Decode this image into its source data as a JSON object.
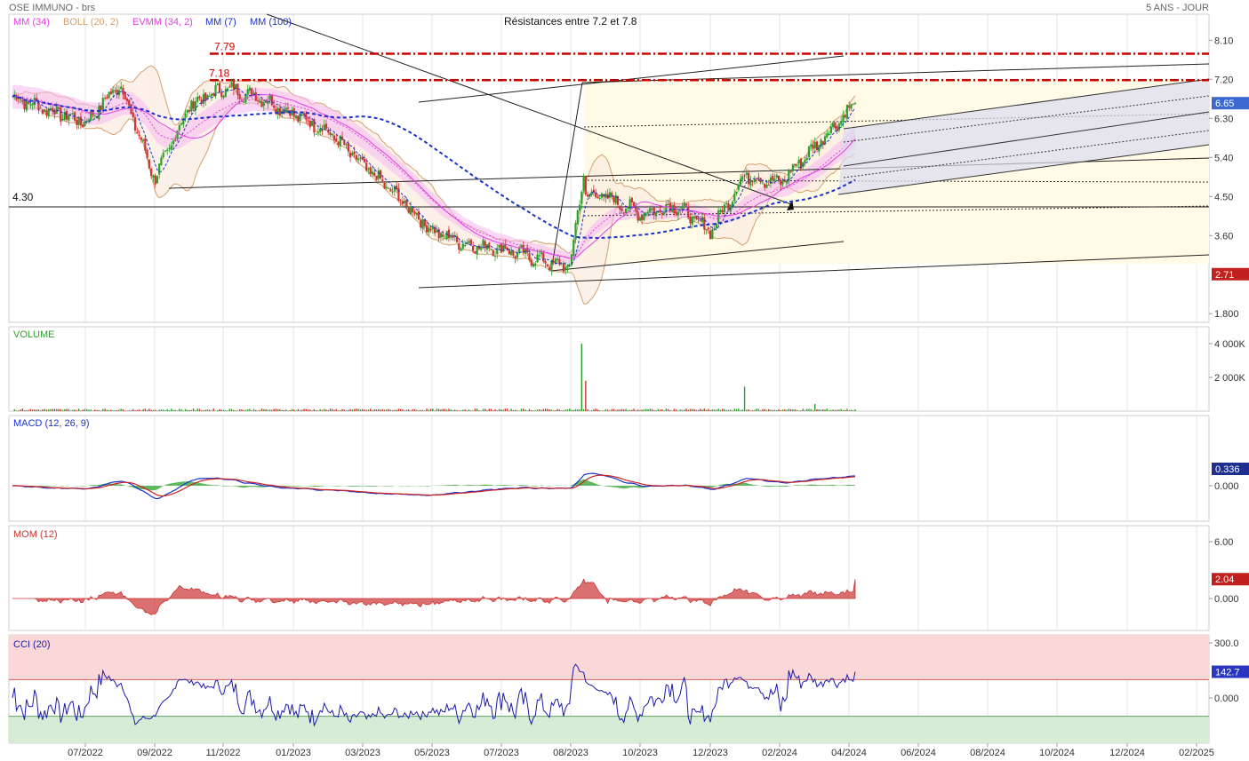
{
  "header": {
    "title": "OSE IMMUNO - brs",
    "period": "5 ANS - JOUR",
    "annotation": "Résistances entre 7.2 et 7.8"
  },
  "colors": {
    "candle_up": "#2ca02c",
    "candle_down": "#cc3333",
    "mm34": "#e040e0",
    "boll": "#d4a070",
    "mm100": "#1a33cc",
    "resistance": "#cc0000",
    "macd": "#1a33cc",
    "signal": "#cc2222",
    "hist": "#2ca02c",
    "mom": "#cc3333",
    "cci": "#1a1aaa",
    "overbought_zone": "#fbd8d8",
    "oversold_zone": "#d6ecd6"
  },
  "chart_data": [
    {
      "type": "candlestick",
      "panel": "price",
      "legend": [
        "MM (34)",
        "BOLL (20, 2)",
        "EVMM (34, 2)",
        "MM (7)",
        "MM (100)"
      ],
      "y_ticks": [
        "8.10",
        "7.20",
        "6.30",
        "5.40",
        "4.50",
        "3.60",
        "1.800"
      ],
      "ylim": [
        1.6,
        8.7
      ],
      "last_price": "6.65",
      "price_marker": "2.71",
      "support_label": "4.30",
      "support_value": 4.3,
      "resistances": [
        {
          "label": "7.79",
          "value": 7.79
        },
        {
          "label": "7.18",
          "value": 7.18
        }
      ],
      "close_anchors": [
        {
          "x": "06/2022",
          "y": 6.8
        },
        {
          "x": "07/2022",
          "y": 6.2
        },
        {
          "x": "08/2022",
          "y": 7.1
        },
        {
          "x": "09/2022",
          "y": 4.9
        },
        {
          "x": "10/2022",
          "y": 6.6
        },
        {
          "x": "11/2022",
          "y": 7.0
        },
        {
          "x": "12/2022",
          "y": 6.8
        },
        {
          "x": "01/2023",
          "y": 6.4
        },
        {
          "x": "02/2023",
          "y": 6.0
        },
        {
          "x": "03/2023",
          "y": 5.2
        },
        {
          "x": "04/2023",
          "y": 4.5
        },
        {
          "x": "05/2023",
          "y": 3.7
        },
        {
          "x": "06/2023",
          "y": 3.4
        },
        {
          "x": "07/2023",
          "y": 3.3
        },
        {
          "x": "08/2023",
          "y": 2.85
        },
        {
          "x": "08/2023",
          "y": 5.0
        },
        {
          "x": "09/2023",
          "y": 4.6
        },
        {
          "x": "10/2023",
          "y": 4.5
        },
        {
          "x": "11/2023",
          "y": 4.1
        },
        {
          "x": "12/2023",
          "y": 4.3
        },
        {
          "x": "01/2024",
          "y": 3.7
        },
        {
          "x": "02/2024",
          "y": 5.0
        },
        {
          "x": "03/2024",
          "y": 4.8
        },
        {
          "x": "04/2024",
          "y": 6.65
        }
      ]
    },
    {
      "type": "bar",
      "panel": "volume",
      "legend": "VOLUME",
      "y_ticks": [
        "4 000K",
        "2 000K"
      ],
      "ylim": [
        0,
        5000
      ],
      "spikes_k": [
        {
          "x": "08/2023",
          "value": 4000
        },
        {
          "x": "08/2023",
          "value": 1800
        },
        {
          "x": "02/2024",
          "value": 1450
        },
        {
          "x": "04/2024",
          "value": 420
        }
      ]
    },
    {
      "type": "line",
      "panel": "macd",
      "legend": "MACD (12, 26, 9)",
      "y_ticks": [
        "0.000"
      ],
      "last_value": "0.336"
    },
    {
      "type": "area",
      "panel": "momentum",
      "legend": "MOM (12)",
      "y_ticks": [
        "6.00",
        "0.000"
      ],
      "ylim": [
        -3,
        8
      ],
      "last_value": "2.04"
    },
    {
      "type": "line",
      "panel": "cci",
      "legend": "CCI (20)",
      "y_ticks": [
        "300.0",
        "0.000"
      ],
      "ylim": [
        -300,
        380
      ],
      "last_value": "142.7",
      "overbought": 100,
      "oversold": -100
    }
  ],
  "x_ticks": [
    "07/2022",
    "09/2022",
    "11/2022",
    "01/2023",
    "03/2023",
    "05/2023",
    "07/2023",
    "08/2023",
    "10/2023",
    "12/2023",
    "02/2024",
    "04/2024",
    "06/2024",
    "08/2024",
    "10/2024",
    "12/2024",
    "02/2025"
  ]
}
